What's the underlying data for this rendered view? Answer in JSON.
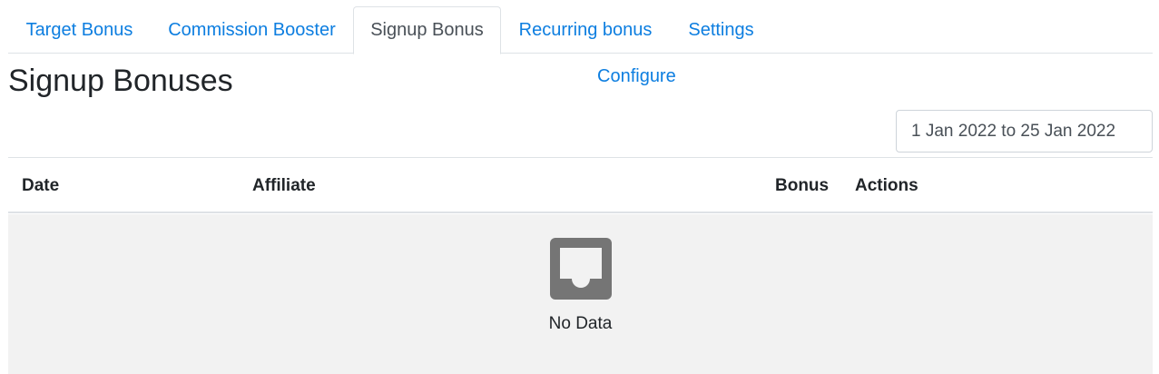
{
  "tabs": [
    {
      "label": "Target Bonus",
      "active": false
    },
    {
      "label": "Commission Booster",
      "active": false
    },
    {
      "label": "Signup Bonus",
      "active": true
    },
    {
      "label": "Recurring bonus",
      "active": false
    },
    {
      "label": "Settings",
      "active": false
    }
  ],
  "page": {
    "title": "Signup Bonuses",
    "configure_label": "Configure"
  },
  "filter": {
    "date_range": "1 Jan 2022 to 25 Jan 2022"
  },
  "table": {
    "columns": [
      "Date",
      "Affiliate",
      "Bonus",
      "Actions"
    ],
    "rows": [],
    "empty_text": "No Data",
    "empty_icon": "inbox-icon"
  },
  "colors": {
    "link": "#0d7ee0",
    "empty_background": "#f2f2f2",
    "empty_icon": "#757575"
  }
}
